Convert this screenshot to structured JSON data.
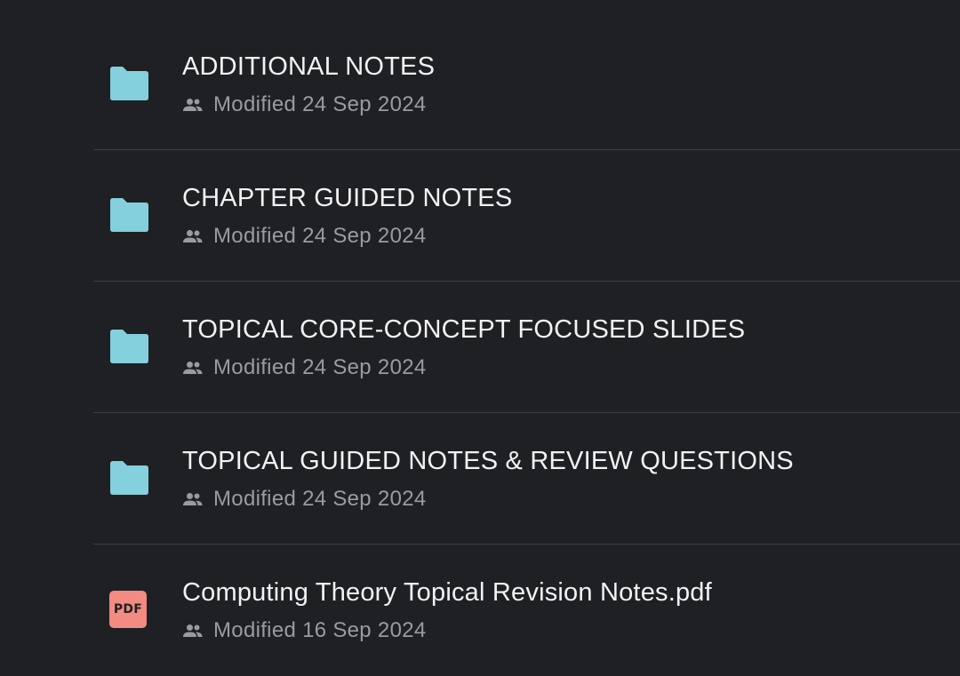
{
  "colors": {
    "background": "#1f2024",
    "folder": "#84d0dd",
    "pdf": "#f28b82",
    "title_text": "#f2f2f4",
    "meta_text": "#9a9ba1",
    "divider": "#3d3e43"
  },
  "items": [
    {
      "type": "folder",
      "icon": "folder-icon",
      "title": "ADDITIONAL NOTES",
      "shared_icon": "people-icon",
      "modified": "Modified 24 Sep 2024"
    },
    {
      "type": "folder",
      "icon": "folder-icon",
      "title": "CHAPTER GUIDED NOTES",
      "shared_icon": "people-icon",
      "modified": "Modified 24 Sep 2024"
    },
    {
      "type": "folder",
      "icon": "folder-icon",
      "title": "TOPICAL CORE-CONCEPT FOCUSED SLIDES",
      "shared_icon": "people-icon",
      "modified": "Modified 24 Sep 2024"
    },
    {
      "type": "folder",
      "icon": "folder-icon",
      "title": "TOPICAL GUIDED NOTES & REVIEW QUESTIONS",
      "shared_icon": "people-icon",
      "modified": "Modified 24 Sep 2024"
    },
    {
      "type": "pdf",
      "icon": "pdf-file-icon",
      "badge": "PDF",
      "title": "Computing Theory Topical Revision Notes.pdf",
      "shared_icon": "people-icon",
      "modified": "Modified 16 Sep 2024"
    }
  ]
}
